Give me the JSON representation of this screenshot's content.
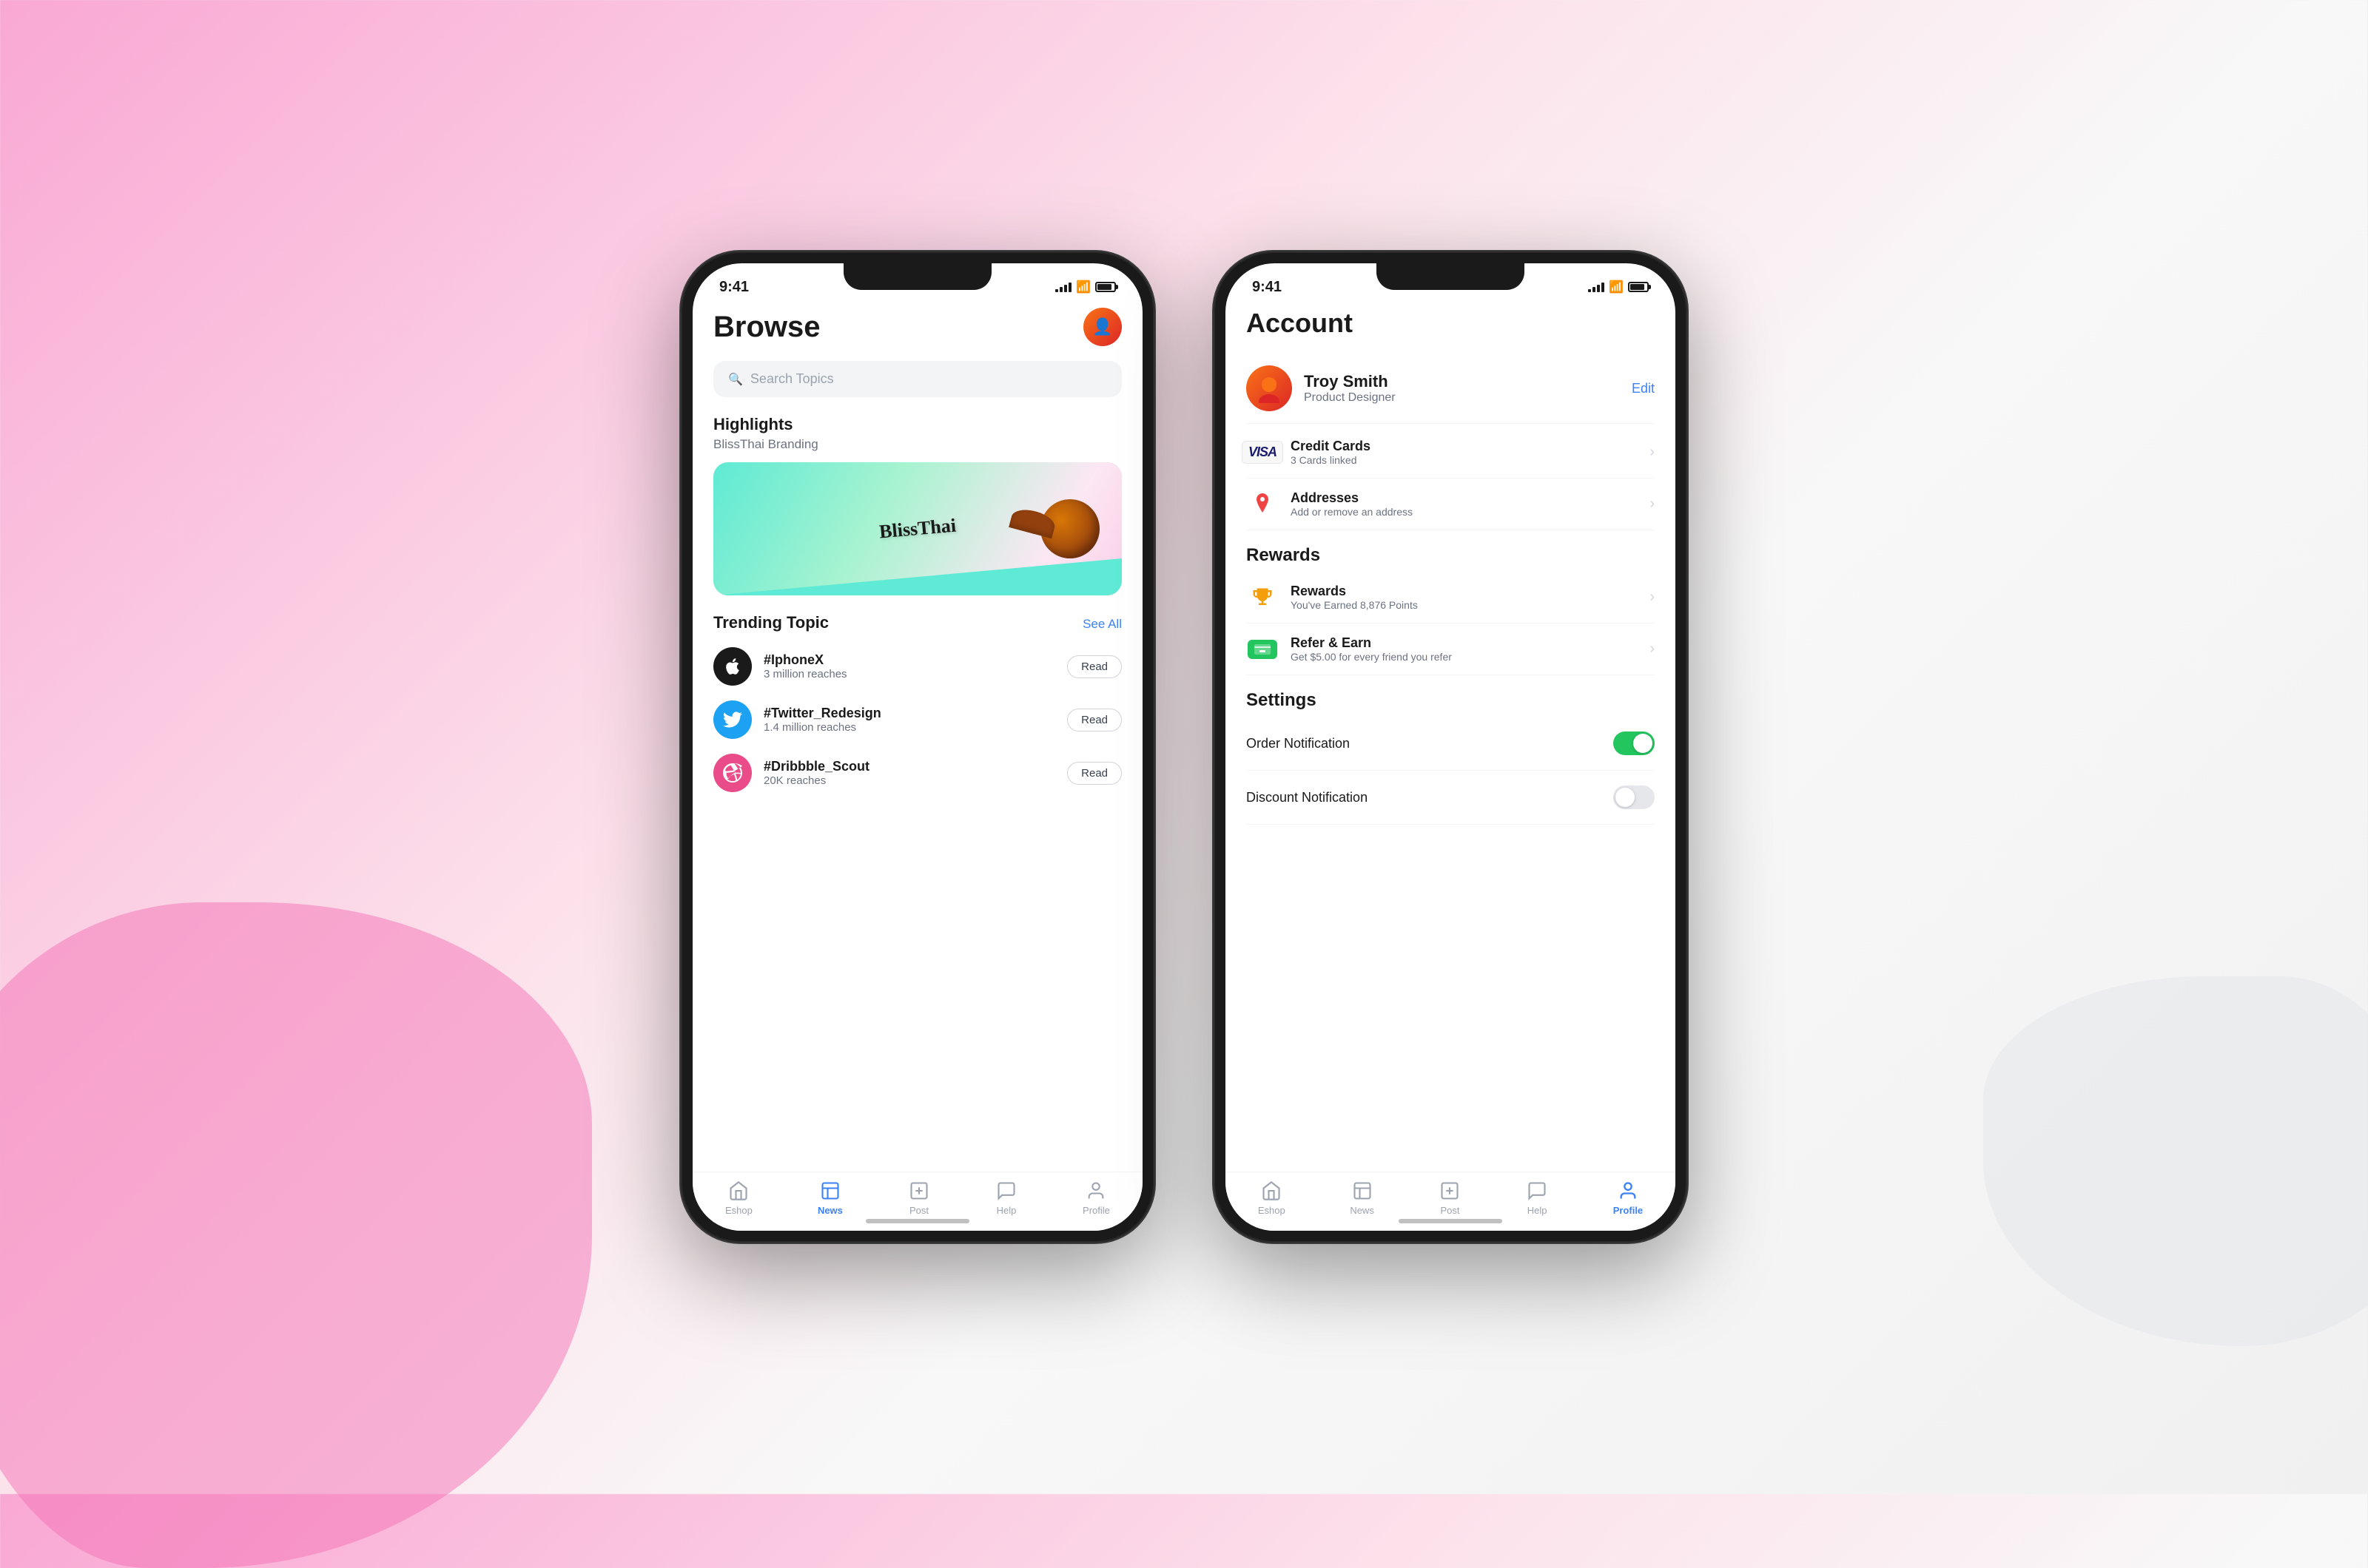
{
  "background": {
    "color_left": "#f9a8d4",
    "color_right": "#f0f0f0"
  },
  "phone_left": {
    "status_bar": {
      "time": "9:41",
      "signal": "●●●●",
      "wifi": "WiFi",
      "battery": "80%"
    },
    "screen": {
      "title": "Browse",
      "search_placeholder": "Search Topics",
      "highlights_label": "Highlights",
      "highlights_sub": "BlissThai Branding",
      "trending_label": "Trending Topic",
      "see_all": "See All",
      "topics": [
        {
          "name": "#IphoneX",
          "reach": "3 million reaches",
          "read": "Read",
          "icon_type": "apple"
        },
        {
          "name": "#Twitter_Redesign",
          "reach": "1.4 million reaches",
          "read": "Read",
          "icon_type": "twitter"
        },
        {
          "name": "#Dribbble_Scout",
          "reach": "20K reaches",
          "read": "Read",
          "icon_type": "dribbble"
        }
      ],
      "nav": [
        {
          "id": "eshop",
          "label": "Eshop",
          "active": false
        },
        {
          "id": "news",
          "label": "News",
          "active": true
        },
        {
          "id": "post",
          "label": "Post",
          "active": false
        },
        {
          "id": "help",
          "label": "Help",
          "active": false
        },
        {
          "id": "profile",
          "label": "Profile",
          "active": false
        }
      ]
    }
  },
  "phone_right": {
    "status_bar": {
      "time": "9:41",
      "signal": "●●●●",
      "wifi": "WiFi",
      "battery": "80%"
    },
    "screen": {
      "title": "Account",
      "profile": {
        "name": "Troy Smith",
        "role": "Product Designer",
        "edit_label": "Edit"
      },
      "sections": [
        {
          "id": "account_section",
          "items": [
            {
              "id": "credit_cards",
              "title": "Credit Cards",
              "sub": "3 Cards linked",
              "icon": "visa",
              "has_chevron": true
            },
            {
              "id": "addresses",
              "title": "Addresses",
              "sub": "Add or remove an address",
              "icon": "pin",
              "has_chevron": true
            }
          ]
        },
        {
          "id": "rewards_section",
          "label": "Rewards",
          "items": [
            {
              "id": "rewards",
              "title": "Rewards",
              "sub": "You've Earned 8,876 Points",
              "icon": "trophy",
              "has_chevron": true
            },
            {
              "id": "refer_earn",
              "title": "Refer & Earn",
              "sub": "Get $5.00 for every friend you refer",
              "icon": "refer",
              "has_chevron": true
            }
          ]
        },
        {
          "id": "settings_section",
          "label": "Settings",
          "items": [
            {
              "id": "order_notif",
              "title": "Order Notification",
              "toggle": true,
              "toggle_on": true
            },
            {
              "id": "discount_notif",
              "title": "Discount Notification",
              "toggle": true,
              "toggle_on": false
            }
          ]
        }
      ],
      "nav": [
        {
          "id": "eshop",
          "label": "Eshop",
          "active": false
        },
        {
          "id": "news",
          "label": "News",
          "active": false
        },
        {
          "id": "post",
          "label": "Post",
          "active": false
        },
        {
          "id": "help",
          "label": "Help",
          "active": false
        },
        {
          "id": "profile",
          "label": "Profile",
          "active": true
        }
      ]
    }
  }
}
